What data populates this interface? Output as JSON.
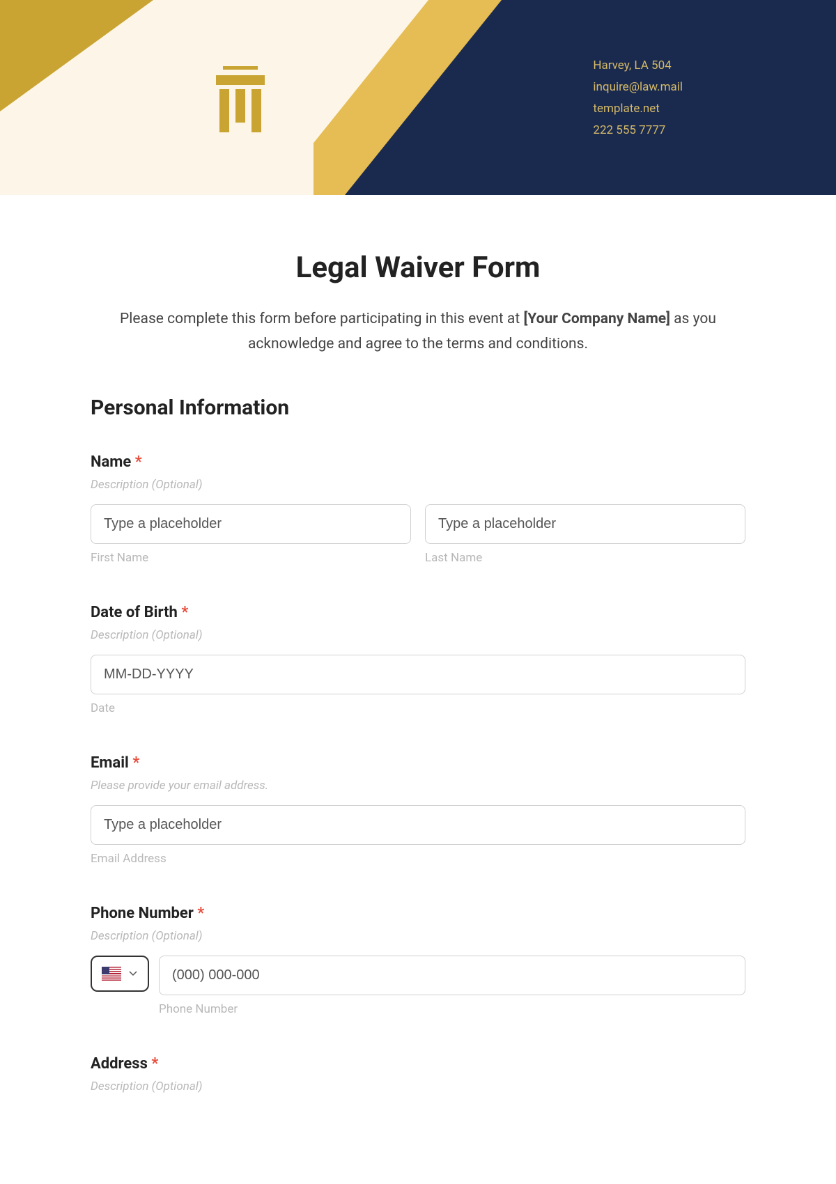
{
  "header": {
    "contact": {
      "address": "Harvey, LA 504",
      "email": "inquire@law.mail",
      "website": "template.net",
      "phone": "222 555 7777"
    }
  },
  "form": {
    "title": "Legal Waiver Form",
    "intro_prefix": "Please complete this form before participating in this event at ",
    "company_name": "[Your Company Name]",
    "intro_suffix": " as you acknowledge and agree to the terms and conditions.",
    "section_heading": "Personal Information",
    "fields": {
      "name": {
        "label": "Name",
        "description": "Description (Optional)",
        "first_placeholder": "Type a placeholder",
        "first_sublabel": "First Name",
        "last_placeholder": "Type a placeholder",
        "last_sublabel": "Last Name"
      },
      "dob": {
        "label": "Date of Birth",
        "description": "Description (Optional)",
        "placeholder": "MM-DD-YYYY",
        "sublabel": "Date"
      },
      "email": {
        "label": "Email",
        "description": "Please provide your email address.",
        "placeholder": "Type a placeholder",
        "sublabel": "Email Address"
      },
      "phone": {
        "label": "Phone Number",
        "description": "Description (Optional)",
        "placeholder": "(000) 000-000",
        "sublabel": "Phone Number"
      },
      "address": {
        "label": "Address",
        "description": "Description (Optional)"
      }
    }
  }
}
